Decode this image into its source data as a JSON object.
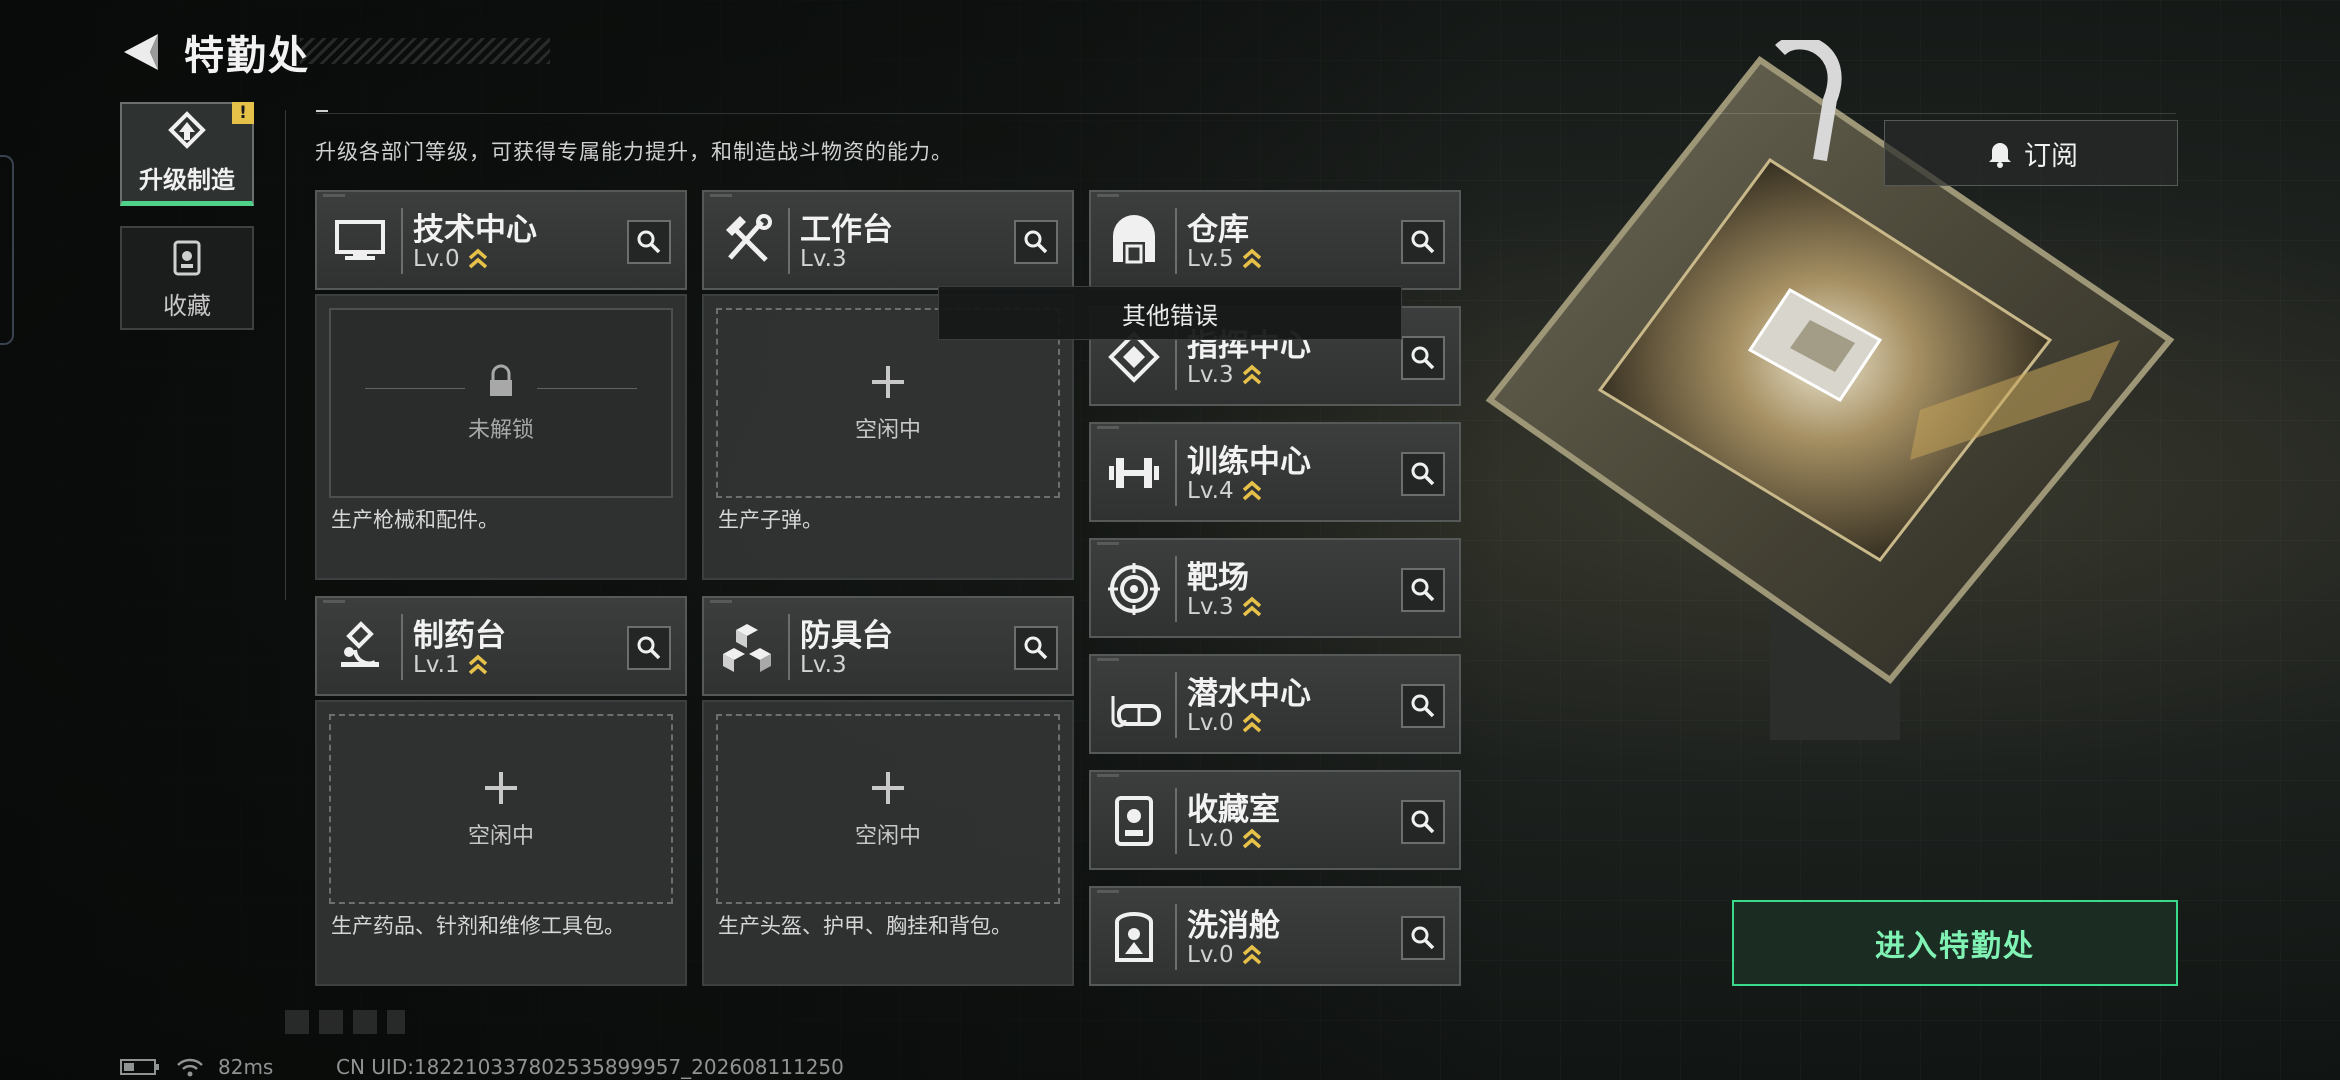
{
  "header": {
    "title": "特勤处"
  },
  "side_tabs": [
    {
      "label": "升级制造",
      "badge": "!",
      "active": true
    },
    {
      "label": "收藏",
      "active": false
    }
  ],
  "description": "升级各部门等级，可获得专属能力提升，和制造战斗物资的能力。",
  "facilities": {
    "tech_center": {
      "name": "技术中心",
      "level": "Lv.0",
      "slot_status": "未解锁",
      "product_desc": "生产枪械和配件。"
    },
    "workbench": {
      "name": "工作台",
      "level": "Lv.3",
      "slot_status": "空闲中",
      "product_desc": "生产子弹。"
    },
    "pharmacy": {
      "name": "制药台",
      "level": "Lv.1",
      "slot_status": "空闲中",
      "product_desc": "生产药品、针剂和维修工具包。"
    },
    "armor_bench": {
      "name": "防具台",
      "level": "Lv.3",
      "slot_status": "空闲中",
      "product_desc": "生产头盔、护甲、胸挂和背包。"
    },
    "warehouse": {
      "name": "仓库",
      "level": "Lv.5"
    },
    "command_center": {
      "name": "指挥中心",
      "level": "Lv.3"
    },
    "training_center": {
      "name": "训练中心",
      "level": "Lv.4"
    },
    "shooting_range": {
      "name": "靶场",
      "level": "Lv.3"
    },
    "diving_center": {
      "name": "潜水中心",
      "level": "Lv.0"
    },
    "collection_room": {
      "name": "收藏室",
      "level": "Lv.0"
    },
    "decon_chamber": {
      "name": "洗消舱",
      "level": "Lv.0"
    }
  },
  "tooltip": "其他错误",
  "subscribe_label": "订阅",
  "enter_label": "进入特勤处",
  "status_bar": {
    "ping": "82ms",
    "uid": "CN UID:182210337802535899957_202608111250"
  },
  "colors": {
    "accent_green": "#3bd98a",
    "upgrade_chevron": "#e6c14a",
    "alert_badge": "#e6c14a"
  },
  "icons": {
    "back": "back-arrow-icon",
    "upgrade_tab": "upgrade-icon",
    "collection_tab": "collection-icon",
    "tech_center": "monitor-icon",
    "workbench": "tools-icon",
    "pharmacy": "microscope-icon",
    "armor_bench": "cubes-icon",
    "warehouse": "warehouse-icon",
    "command_center": "command-icon",
    "training_center": "dumbbell-icon",
    "shooting_range": "target-icon",
    "diving_center": "diving-mask-icon",
    "collection_room": "display-case-icon",
    "decon_chamber": "decon-icon",
    "search": "search-icon",
    "lock": "lock-icon",
    "plus": "plus-icon",
    "upgrade_chevron": "double-chevron-up-icon"
  }
}
